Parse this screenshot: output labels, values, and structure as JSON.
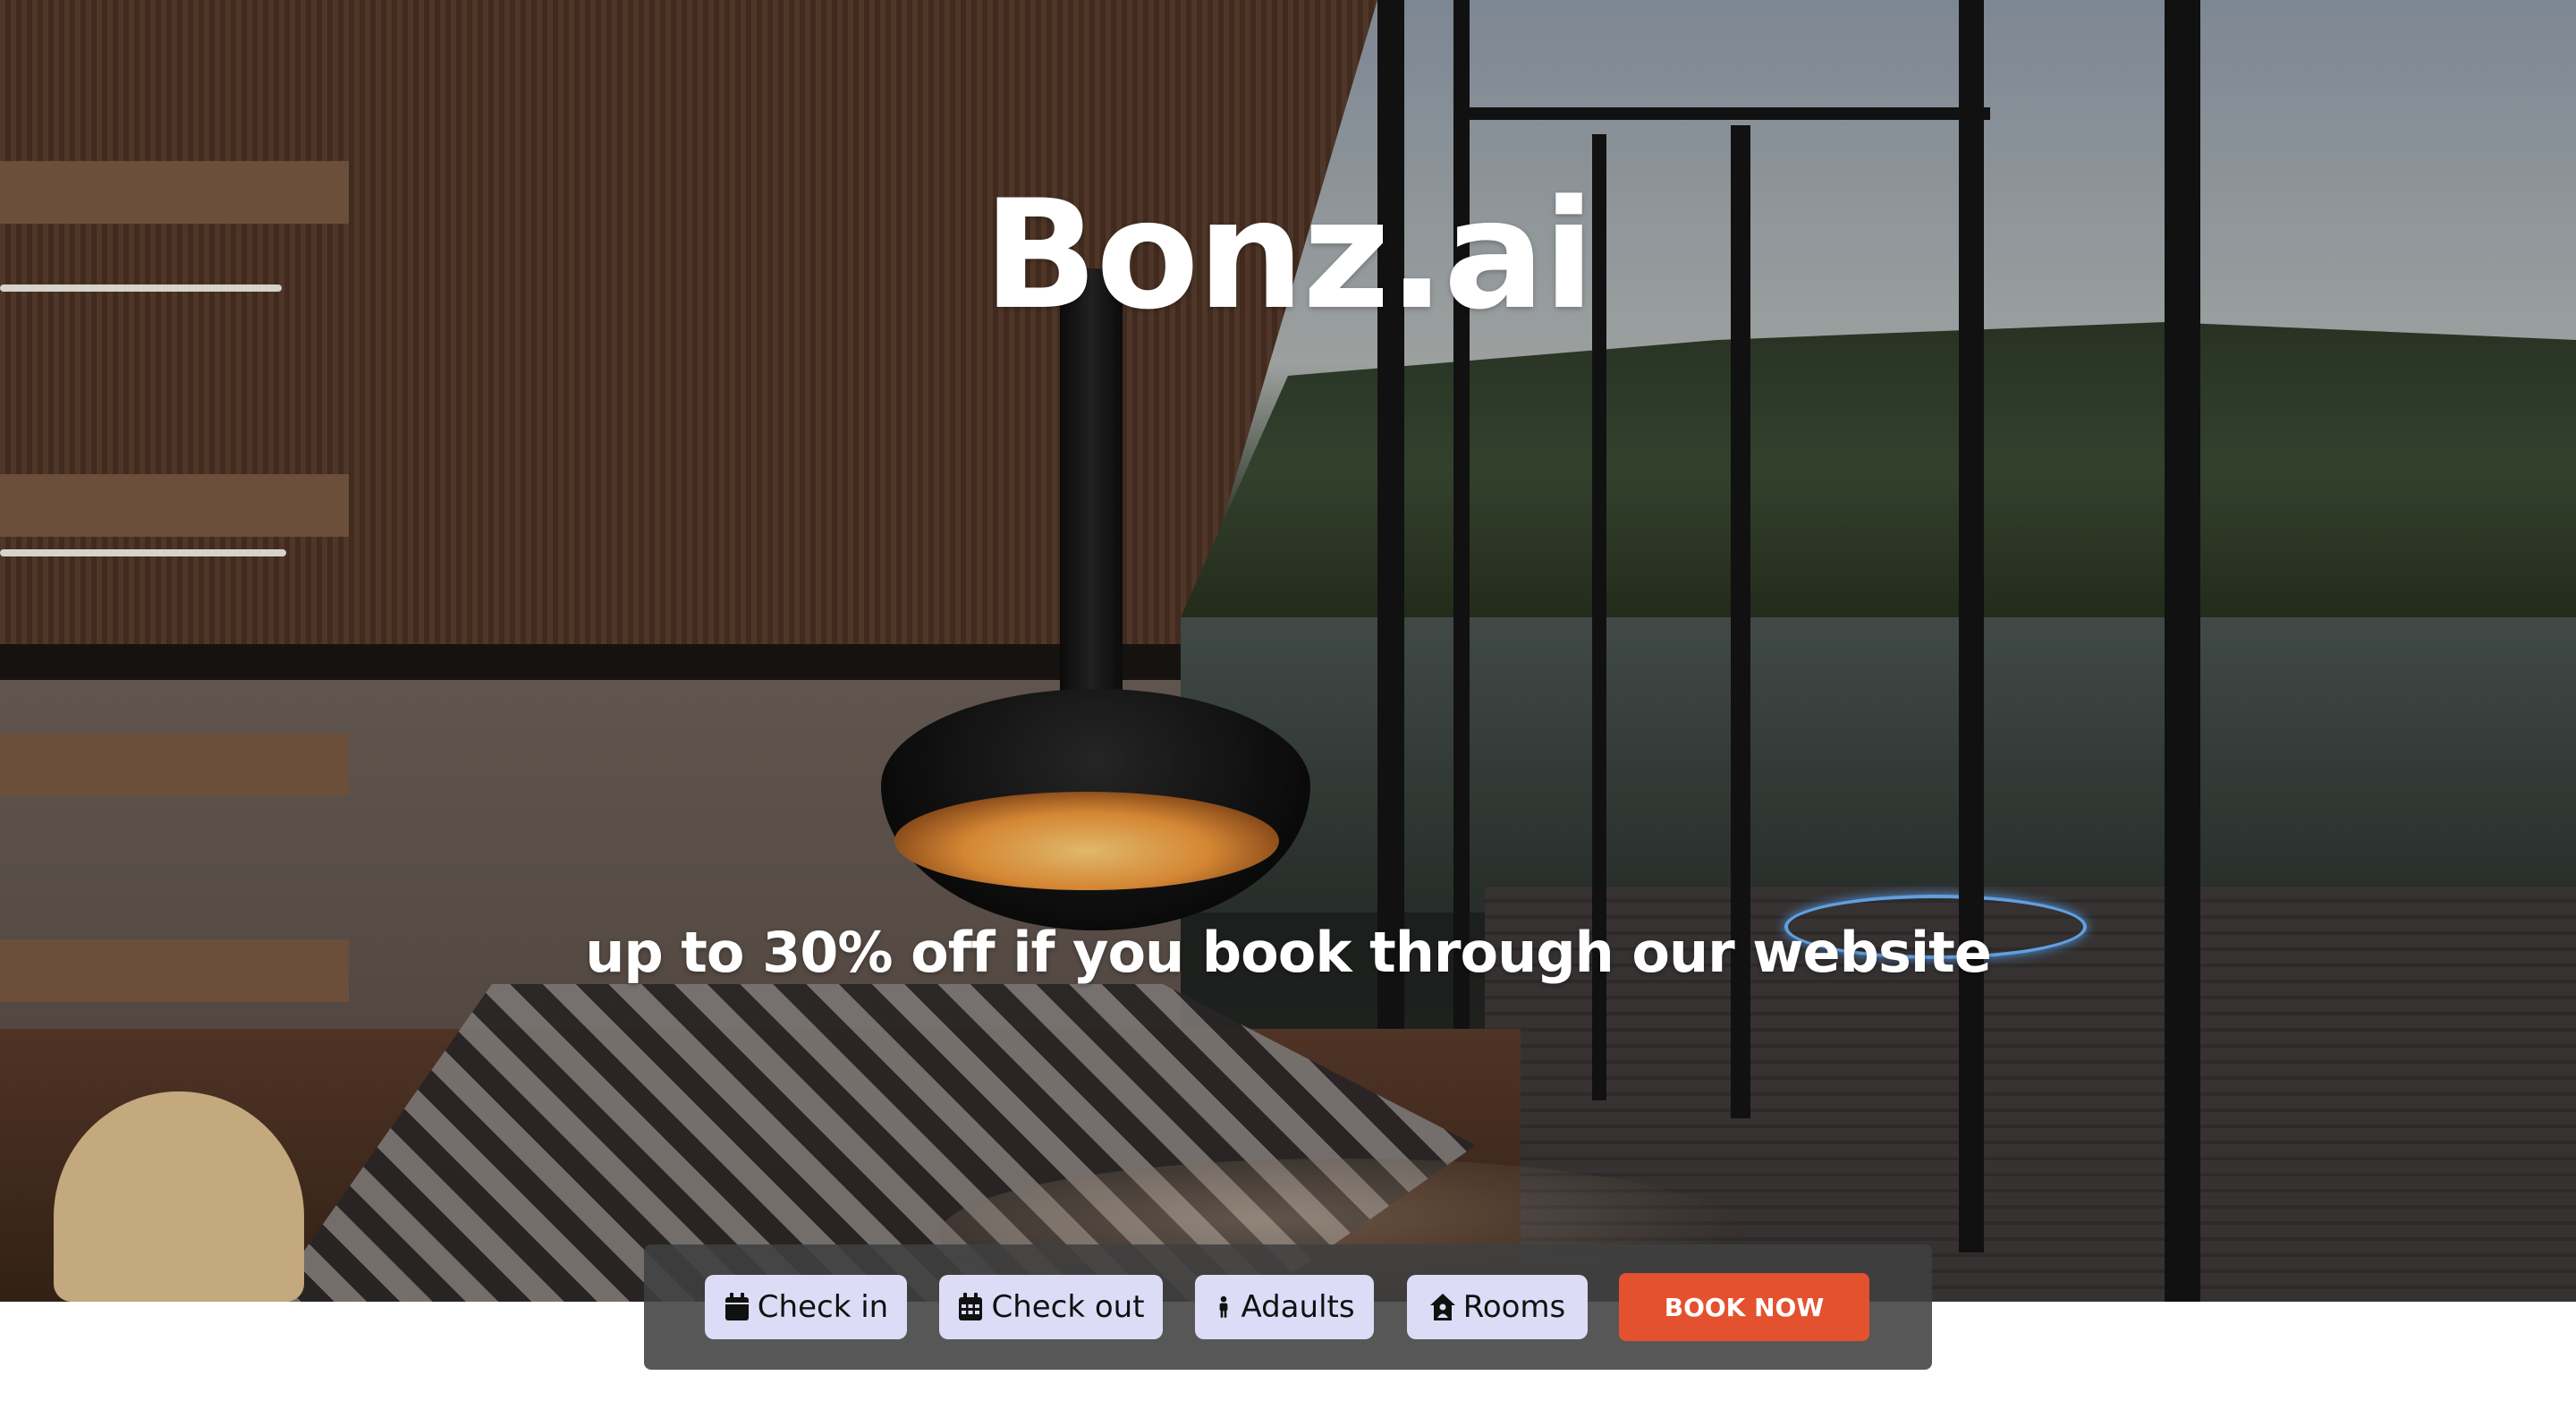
{
  "hero": {
    "brand_title": "Bonz.ai",
    "promo_text": "up to 30% off if you book through our website",
    "background_image": "cabin-interior-fireplace-lake-view"
  },
  "booking_bar": {
    "check_in_label": "Check in",
    "check_out_label": "Check out",
    "adults_label": "Adaults",
    "rooms_label": "Rooms",
    "book_now_label": "BOOK NOW",
    "icons": {
      "check_in": "calendar-icon",
      "check_out": "calendar-grid-icon",
      "adults": "person-icon",
      "rooms": "house-user-icon"
    }
  },
  "colors": {
    "book_now_bg": "#e4512f",
    "field_bg": "#dcdcf7",
    "bar_bg": "#404040"
  }
}
